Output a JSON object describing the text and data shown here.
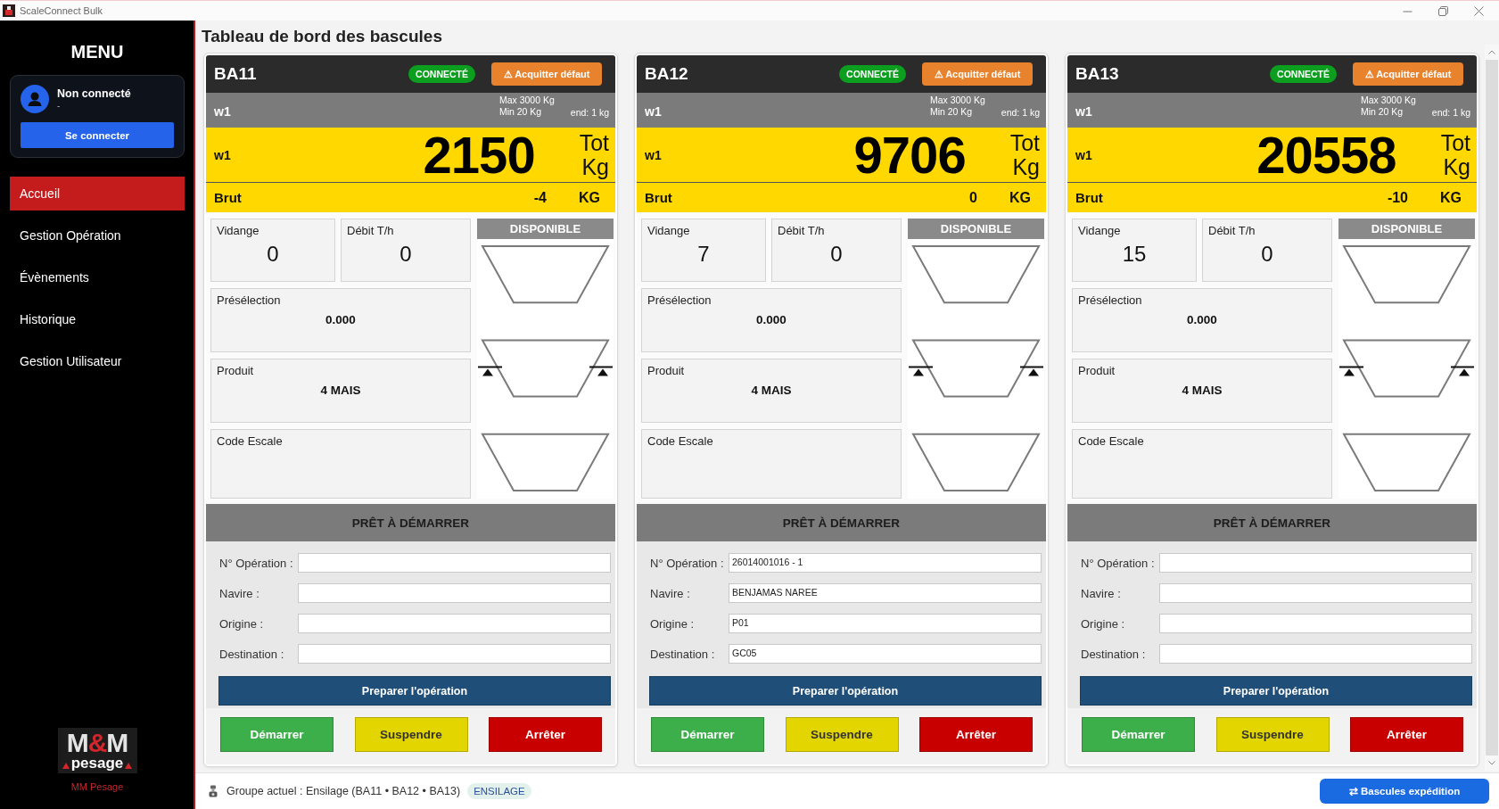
{
  "window": {
    "title": "ScaleConnect Bulk"
  },
  "sidebar": {
    "heading": "MENU",
    "user": {
      "name": "Non connecté",
      "detail": "-",
      "login_button": "Se connecter"
    },
    "items": [
      {
        "label": "Accueil",
        "selected": true
      },
      {
        "label": "Gestion Opération",
        "selected": false
      },
      {
        "label": "Évènements",
        "selected": false
      },
      {
        "label": "Historique",
        "selected": false
      },
      {
        "label": "Gestion Utilisateur",
        "selected": false
      }
    ],
    "logo": {
      "mark": [
        "M",
        "&",
        "M"
      ],
      "wordmark": "pesage",
      "caption": "MM Pesage"
    }
  },
  "page_title": "Tableau de bord des bascules",
  "scales": [
    {
      "name": "BA11",
      "status": "CONNECTÉ",
      "connected": true,
      "fault_button": "⚠ Acquitter défaut",
      "channel": "w1",
      "capacity_max": "Max 3000 Kg",
      "capacity_min": "Min 20 Kg",
      "division": "end: 1 kg",
      "display_channel": "w1",
      "total": "2150",
      "total_label": "Tot",
      "total_unit": "Kg",
      "gross_label": "Brut",
      "gross": "-4",
      "gross_unit": "KG",
      "metrics": [
        {
          "label": "Vidange",
          "value": "0"
        },
        {
          "label": "Débit T/h",
          "value": "0"
        }
      ],
      "details": [
        {
          "label": "Présélection",
          "value": "0.000"
        },
        {
          "label": "Produit",
          "value": "4 MAIS"
        },
        {
          "label": "Code Escale"
        }
      ],
      "hopper_status": "DISPONIBLE",
      "state": "PRÊT À DÉMARRER",
      "form": [
        {
          "label": "N° Opération :"
        },
        {
          "label": "Navire :"
        },
        {
          "label": "Origine :"
        },
        {
          "label": "Destination :"
        }
      ],
      "prepare_button": "Preparer l'opération",
      "actions": [
        {
          "label": "Démarrer",
          "kind": "start"
        },
        {
          "label": "Suspendre",
          "kind": "pause"
        },
        {
          "label": "Arrêter",
          "kind": "stop"
        }
      ]
    },
    {
      "name": "BA12",
      "status": "CONNECTÉ",
      "connected": true,
      "fault_button": "⚠ Acquitter défaut",
      "channel": "w1",
      "capacity_max": "Max 3000 Kg",
      "capacity_min": "Min 20 Kg",
      "division": "end: 1 kg",
      "display_channel": "w1",
      "total": "9706",
      "total_label": "Tot",
      "total_unit": "Kg",
      "gross_label": "Brut",
      "gross": "0",
      "gross_unit": "KG",
      "metrics": [
        {
          "label": "Vidange",
          "value": "7"
        },
        {
          "label": "Débit T/h",
          "value": "0"
        }
      ],
      "details": [
        {
          "label": "Présélection",
          "value": "0.000"
        },
        {
          "label": "Produit",
          "value": "4 MAIS"
        },
        {
          "label": "Code Escale"
        }
      ],
      "hopper_status": "DISPONIBLE",
      "state": "PRÊT À DÉMARRER",
      "form": [
        {
          "label": "N° Opération :",
          "value": "26014001016 - 1"
        },
        {
          "label": "Navire :",
          "value": "BENJAMAS NAREE"
        },
        {
          "label": "Origine :",
          "value": "P01"
        },
        {
          "label": "Destination :",
          "value": "GC05"
        }
      ],
      "prepare_button": "Preparer l'opération",
      "actions": [
        {
          "label": "Démarrer",
          "kind": "start"
        },
        {
          "label": "Suspendre",
          "kind": "pause"
        },
        {
          "label": "Arrêter",
          "kind": "stop"
        }
      ]
    },
    {
      "name": "BA13",
      "status": "CONNECTÉ",
      "connected": true,
      "fault_button": "⚠ Acquitter défaut",
      "channel": "w1",
      "capacity_max": "Max 3000 Kg",
      "capacity_min": "Min 20 Kg",
      "division": "end: 1 kg",
      "display_channel": "w1",
      "total": "20558",
      "total_label": "Tot",
      "total_unit": "Kg",
      "gross_label": "Brut",
      "gross": "-10",
      "gross_unit": "KG",
      "metrics": [
        {
          "label": "Vidange",
          "value": "15"
        },
        {
          "label": "Débit T/h",
          "value": "0"
        }
      ],
      "details": [
        {
          "label": "Présélection",
          "value": "0.000"
        },
        {
          "label": "Produit",
          "value": "4 MAIS"
        },
        {
          "label": "Code Escale"
        }
      ],
      "hopper_status": "DISPONIBLE",
      "state": "PRÊT À DÉMARRER",
      "form": [
        {
          "label": "N° Opération :"
        },
        {
          "label": "Navire :"
        },
        {
          "label": "Origine :"
        },
        {
          "label": "Destination :"
        }
      ],
      "prepare_button": "Preparer l'opération",
      "actions": [
        {
          "label": "Démarrer",
          "kind": "start"
        },
        {
          "label": "Suspendre",
          "kind": "pause"
        },
        {
          "label": "Arrêter",
          "kind": "stop"
        }
      ]
    }
  ],
  "status_bar": {
    "group": "Groupe actuel : Ensilage (BA11 • BA12 • BA13)",
    "tag": "ENSILAGE",
    "button": "⇄ Bascules expédition"
  }
}
